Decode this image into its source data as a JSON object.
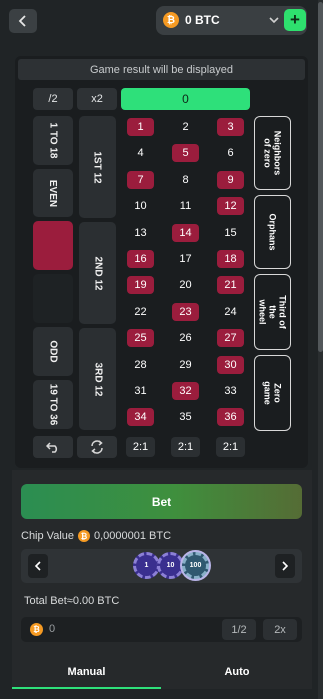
{
  "header": {
    "balance": "0 BTC",
    "currency_icon": "bitcoin-icon",
    "add_label": "+"
  },
  "board": {
    "result_text": "Game result will be displayed",
    "half_label": "/2",
    "double_label": "x2",
    "zero": "0",
    "outside_left": [
      "1 TO 18",
      "EVEN",
      "",
      "",
      "ODD",
      "19 TO 36"
    ],
    "dozens": [
      "1ST 12",
      "2ND 12",
      "3RD 12"
    ],
    "specials": [
      "Neighbors of zero",
      "Orphans",
      "Third of the wheel",
      "Zero game"
    ],
    "numbers": [
      {
        "n": "1",
        "c": "red"
      },
      {
        "n": "2",
        "c": "black"
      },
      {
        "n": "3",
        "c": "red"
      },
      {
        "n": "4",
        "c": "black"
      },
      {
        "n": "5",
        "c": "red"
      },
      {
        "n": "6",
        "c": "black"
      },
      {
        "n": "7",
        "c": "red"
      },
      {
        "n": "8",
        "c": "black"
      },
      {
        "n": "9",
        "c": "red"
      },
      {
        "n": "10",
        "c": "black"
      },
      {
        "n": "11",
        "c": "black"
      },
      {
        "n": "12",
        "c": "red"
      },
      {
        "n": "13",
        "c": "black"
      },
      {
        "n": "14",
        "c": "red"
      },
      {
        "n": "15",
        "c": "black"
      },
      {
        "n": "16",
        "c": "red"
      },
      {
        "n": "17",
        "c": "black"
      },
      {
        "n": "18",
        "c": "red"
      },
      {
        "n": "19",
        "c": "red"
      },
      {
        "n": "20",
        "c": "black"
      },
      {
        "n": "21",
        "c": "red"
      },
      {
        "n": "22",
        "c": "black"
      },
      {
        "n": "23",
        "c": "red"
      },
      {
        "n": "24",
        "c": "black"
      },
      {
        "n": "25",
        "c": "red"
      },
      {
        "n": "26",
        "c": "black"
      },
      {
        "n": "27",
        "c": "red"
      },
      {
        "n": "28",
        "c": "black"
      },
      {
        "n": "29",
        "c": "black"
      },
      {
        "n": "30",
        "c": "red"
      },
      {
        "n": "31",
        "c": "black"
      },
      {
        "n": "32",
        "c": "red"
      },
      {
        "n": "33",
        "c": "black"
      },
      {
        "n": "34",
        "c": "red"
      },
      {
        "n": "35",
        "c": "black"
      },
      {
        "n": "36",
        "c": "red"
      }
    ],
    "columns": [
      "2:1",
      "2:1",
      "2:1"
    ]
  },
  "controls": {
    "bet_label": "Bet",
    "chip_value_label": "Chip Value",
    "chip_value": "0,0000001 BTC",
    "chips": [
      "1",
      "10",
      "100"
    ],
    "total_bet": "Total Bet≈0.00 BTC",
    "bet_amount": "0",
    "half": "1/2",
    "double": "2x"
  },
  "tabs": {
    "manual": "Manual",
    "auto": "Auto"
  },
  "colors": {
    "accent": "#2ee07a",
    "red": "#9b1d3d",
    "bitcoin": "#f59a23"
  }
}
